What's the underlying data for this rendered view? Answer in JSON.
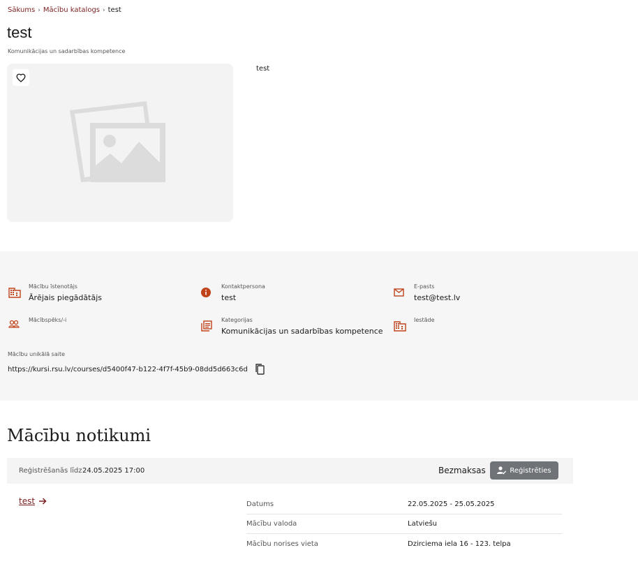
{
  "breadcrumb": {
    "home": "Sākums",
    "catalog": "Mācību katalogs",
    "current": "test"
  },
  "course": {
    "title": "test",
    "competence": "Komunikācijas un sadarbības kompetence",
    "description": "test"
  },
  "info": {
    "provider_label": "Mācību īstenotājs",
    "provider_value": "Ārējais piegādātājs",
    "contact_label": "Kontaktpersona",
    "contact_value": "test",
    "email_label": "E-pasts",
    "email_value": "test@test.lv",
    "trainers_label": "Mācībspēks/-i",
    "category_label": "Kategorijas",
    "category_value": "Komunikācijas un sadarbības kompetence",
    "institution_label": "Iestāde",
    "link_label": "Mācību unikālā saite",
    "link_value": "https://kursi.rsu.lv/courses/d5400f47-b122-4f7f-45b9-08dd5d663c6d"
  },
  "events": {
    "title": "Mācību notikumi",
    "reg_label": "Reģistrēšanās līdz",
    "reg_date": "24.05.2025 17:00",
    "price": "Bezmaksas",
    "register_label": "Reģistrēties",
    "event_name": "test",
    "details": [
      {
        "key": "Datums",
        "value": "22.05.2025 - 25.05.2025"
      },
      {
        "key": "Mācību valoda",
        "value": "Latviešu"
      },
      {
        "key": "Mācību norises vieta",
        "value": "Dzirciema iela 16 - 123. telpa"
      }
    ]
  },
  "colors": {
    "accent": "#7a1f1f",
    "icon": "#c0431a",
    "button": "#6f7377"
  }
}
